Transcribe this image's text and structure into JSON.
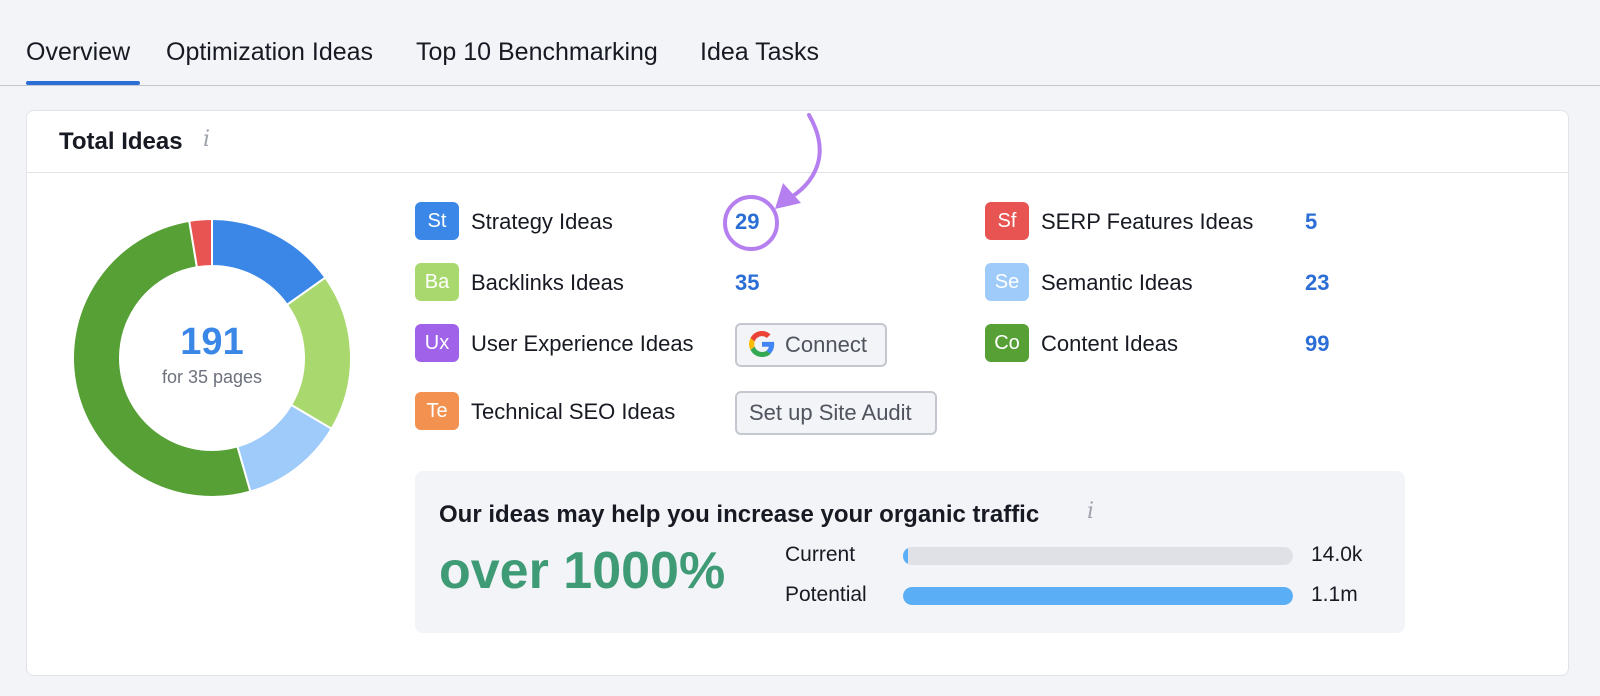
{
  "tabs": [
    {
      "label": "Overview",
      "active": true
    },
    {
      "label": "Optimization Ideas"
    },
    {
      "label": "Top 10 Benchmarking"
    },
    {
      "label": "Idea Tasks"
    }
  ],
  "card": {
    "title": "Total Ideas",
    "info_icon": "i"
  },
  "donut": {
    "total": "191",
    "subtitle": "for 35 pages",
    "segments": [
      {
        "name": "Strategy Ideas",
        "value": 29,
        "color": "#3b87e8"
      },
      {
        "name": "Backlinks Ideas",
        "value": 35,
        "color": "#a9d86e"
      },
      {
        "name": "Semantic Ideas",
        "value": 23,
        "color": "#9ecbf9"
      },
      {
        "name": "Content Ideas",
        "value": 99,
        "color": "#56a036"
      },
      {
        "name": "SERP Features Ideas",
        "value": 5,
        "color": "#e85451"
      }
    ]
  },
  "ideas_left": [
    {
      "abbr": "St",
      "label": "Strategy Ideas",
      "count": "29",
      "color": "#3b87e8"
    },
    {
      "abbr": "Ba",
      "label": "Backlinks Ideas",
      "count": "35",
      "color": "#a9d86e"
    },
    {
      "abbr": "Ux",
      "label": "User Experience Ideas",
      "action": "Connect",
      "color": "#9f62e8"
    },
    {
      "abbr": "Te",
      "label": "Technical SEO Ideas",
      "action": "Set up Site Audit",
      "color": "#f39150"
    }
  ],
  "ideas_right": [
    {
      "abbr": "Sf",
      "label": "SERP Features Ideas",
      "count": "5",
      "color": "#e85451"
    },
    {
      "abbr": "Se",
      "label": "Semantic Ideas",
      "count": "23",
      "color": "#9ecbf9"
    },
    {
      "abbr": "Co",
      "label": "Content Ideas",
      "count": "99",
      "color": "#56a036"
    }
  ],
  "traffic": {
    "title": "Our ideas may help you increase your organic traffic",
    "big_text": "over 1000%",
    "bars": [
      {
        "label": "Current",
        "value": "14.0k",
        "fraction": 0.0127,
        "color": "#5aaef5"
      },
      {
        "label": "Potential",
        "value": "1.1m",
        "fraction": 1.0,
        "color": "#5aaef5"
      }
    ]
  },
  "colors": {
    "accent": "#2b6fd6",
    "highlight": "#b57ff0",
    "traffic_green": "#3f9b75"
  }
}
